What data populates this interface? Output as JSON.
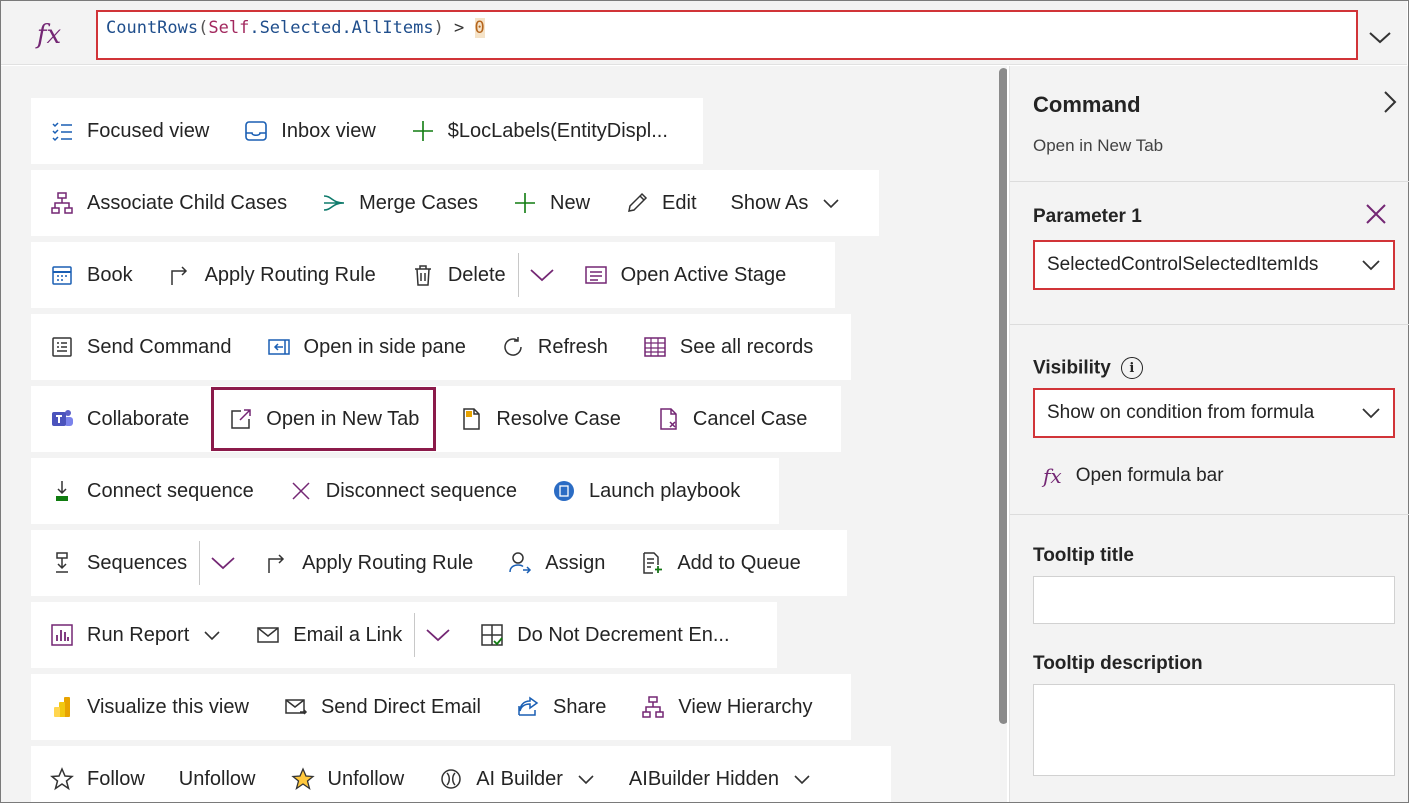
{
  "formula_bar": {
    "fx_symbol": "fx",
    "tokens": [
      {
        "text": "CountRows",
        "cls": "tok-fn"
      },
      {
        "text": "(",
        "cls": "tok-paren"
      },
      {
        "text": "Self",
        "cls": "tok-self"
      },
      {
        "text": ".Selected.AllItems",
        "cls": "tok-fn"
      },
      {
        "text": ")",
        "cls": "tok-paren"
      },
      {
        "text": " > ",
        "cls": "tok-op"
      },
      {
        "text": "0",
        "cls": "tok-num"
      }
    ]
  },
  "canvas": {
    "rows": [
      [
        {
          "label": "Focused view",
          "icon": "list-check-icon"
        },
        {
          "label": "Inbox view",
          "icon": "inbox-icon"
        },
        {
          "label": "$LocLabels(EntityDispl...",
          "icon": "plus-icon"
        }
      ],
      [
        {
          "label": "Associate Child Cases",
          "icon": "hierarchy-icon"
        },
        {
          "label": "Merge Cases",
          "icon": "merge-icon"
        },
        {
          "label": "New",
          "icon": "plus-icon"
        },
        {
          "label": "Edit",
          "icon": "pencil-icon"
        },
        {
          "label": "Show As",
          "icon": "",
          "chevron": true
        }
      ],
      [
        {
          "label": "Book",
          "icon": "calendar-icon"
        },
        {
          "label": "Apply Routing Rule",
          "icon": "route-arrow-icon"
        },
        {
          "label": "Delete",
          "icon": "trash-icon",
          "split": true
        },
        {
          "label": "Open Active Stage",
          "icon": "stage-icon"
        }
      ],
      [
        {
          "label": "Send Command",
          "icon": "command-icon"
        },
        {
          "label": "Open in side pane",
          "icon": "side-pane-icon"
        },
        {
          "label": "Refresh",
          "icon": "refresh-icon"
        },
        {
          "label": "See all records",
          "icon": "table-icon"
        }
      ],
      [
        {
          "label": "Collaborate",
          "icon": "teams-icon"
        },
        {
          "label": "Open in New Tab",
          "icon": "open-new-tab-icon",
          "selected": true
        },
        {
          "label": "Resolve Case",
          "icon": "document-icon"
        },
        {
          "label": "Cancel Case",
          "icon": "document-cancel-icon"
        }
      ],
      [
        {
          "label": "Connect sequence",
          "icon": "connect-sequence-icon"
        },
        {
          "label": "Disconnect sequence",
          "icon": "close-icon"
        },
        {
          "label": "Launch playbook",
          "icon": "playbook-icon"
        }
      ],
      [
        {
          "label": "Sequences",
          "icon": "sequence-icon",
          "split": true
        },
        {
          "label": "Apply Routing Rule",
          "icon": "route-arrow-icon"
        },
        {
          "label": "Assign",
          "icon": "assign-icon"
        },
        {
          "label": "Add to Queue",
          "icon": "queue-icon"
        }
      ],
      [
        {
          "label": "Run Report",
          "icon": "report-icon",
          "chevron": true
        },
        {
          "label": "Email a Link",
          "icon": "email-icon",
          "split": true
        },
        {
          "label": "Do Not Decrement En...",
          "icon": "grid-check-icon"
        }
      ],
      [
        {
          "label": "Visualize this view",
          "icon": "powerbi-icon"
        },
        {
          "label": "Send Direct Email",
          "icon": "email-send-icon"
        },
        {
          "label": "Share",
          "icon": "share-icon"
        },
        {
          "label": "View Hierarchy",
          "icon": "hierarchy-icon"
        }
      ],
      [
        {
          "label": "Follow",
          "icon": "star-icon"
        },
        {
          "label": "Unfollow",
          "icon": ""
        },
        {
          "label": "Unfollow",
          "icon": "star-filled-icon"
        },
        {
          "label": "AI Builder",
          "icon": "ai-builder-icon",
          "chevron": true
        },
        {
          "label": "AIBuilder Hidden",
          "icon": "",
          "chevron": true
        }
      ]
    ]
  },
  "panel": {
    "title": "Command",
    "subtitle": "Open in New Tab",
    "param_label": "Parameter 1",
    "param_value": "SelectedControlSelectedItemIds",
    "visibility_label": "Visibility",
    "info_glyph": "i",
    "visibility_value": "Show on condition from formula",
    "open_formula_label": "Open formula bar",
    "fx_symbol": "fx",
    "tooltip_title_label": "Tooltip title",
    "tooltip_title_value": "",
    "tooltip_desc_label": "Tooltip description",
    "tooltip_desc_value": ""
  },
  "colors": {
    "accent": "#742774",
    "highlight": "#d13438",
    "selected_border": "#8b1a4a"
  }
}
